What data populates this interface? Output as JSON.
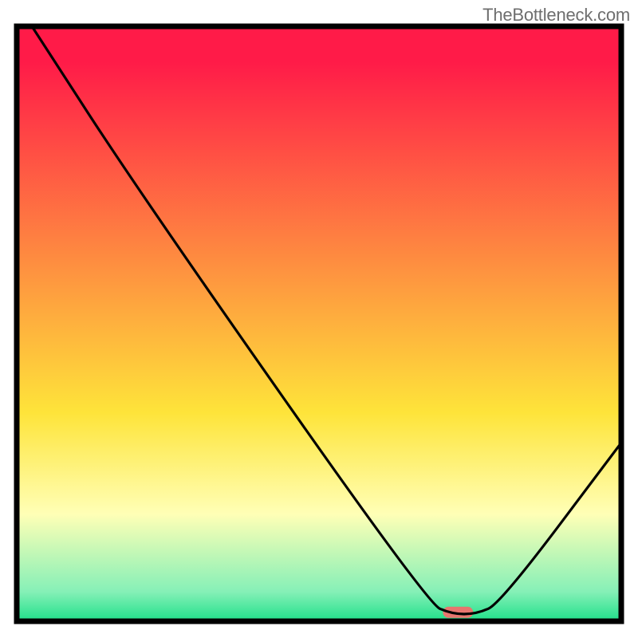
{
  "attribution": "TheBottleneck.com",
  "chart_data": {
    "type": "line",
    "title": "",
    "xlabel": "",
    "ylabel": "",
    "xlim": [
      0,
      100
    ],
    "ylim": [
      0,
      100
    ],
    "background_gradient": {
      "top_color": "#ff1b48",
      "mid_color": "#fee43a",
      "bottom_color": "#1fe08a"
    },
    "curve": [
      {
        "x": 2.5,
        "y": 100
      },
      {
        "x": 21,
        "y": 71
      },
      {
        "x": 68,
        "y": 3
      },
      {
        "x": 72,
        "y": 1.2
      },
      {
        "x": 76,
        "y": 1.2
      },
      {
        "x": 80,
        "y": 3
      },
      {
        "x": 100,
        "y": 30
      }
    ],
    "marker": {
      "x_center": 73,
      "y": 1.5,
      "width_pct": 5,
      "color": "#e7766e"
    },
    "frame_color": "#000000",
    "curve_color": "#000000"
  }
}
